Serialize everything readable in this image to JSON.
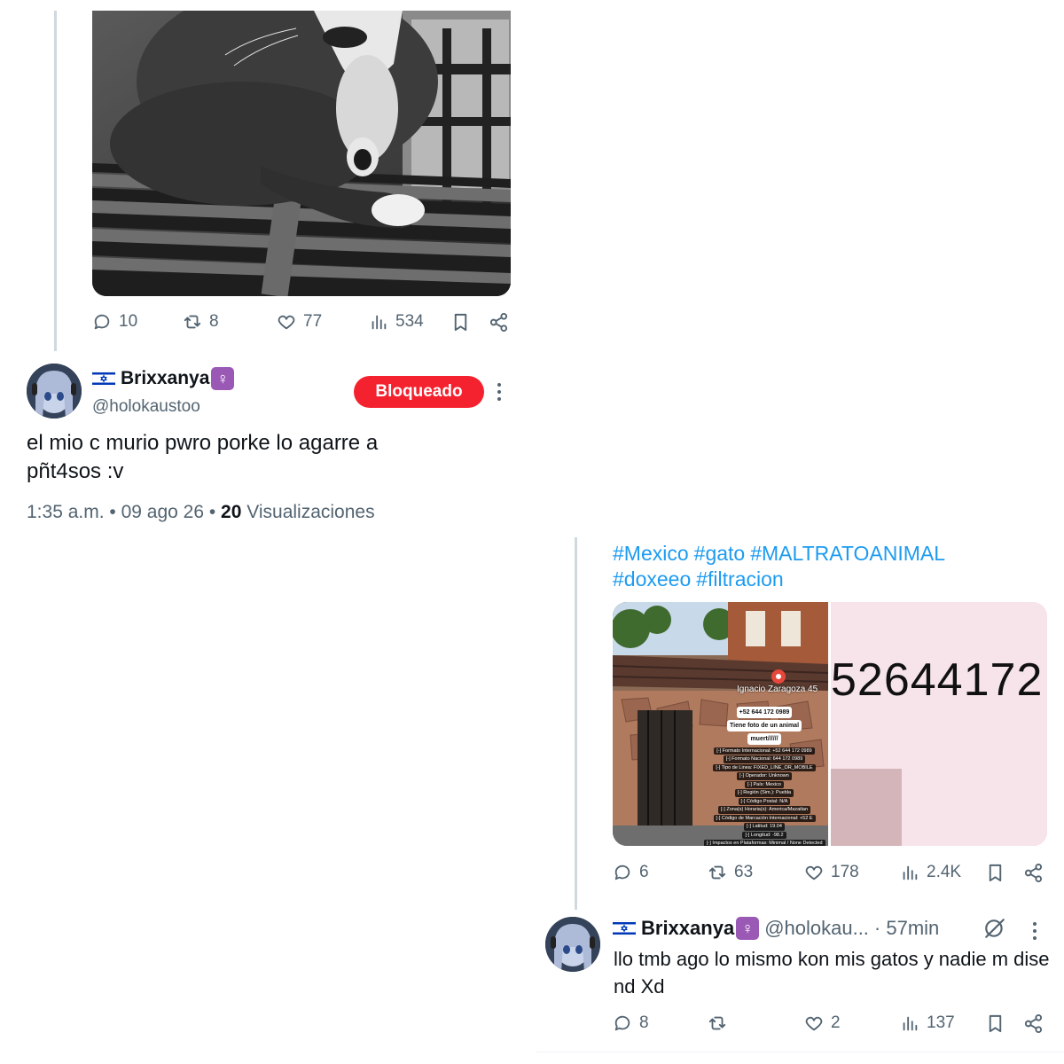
{
  "top_post": {
    "stats": {
      "replies": "10",
      "reposts": "8",
      "likes": "77",
      "views": "534"
    }
  },
  "quoted_reply": {
    "user": {
      "display_name": "Brixxanya",
      "gender_symbol": "♀️",
      "handle": "@holokaustoo",
      "flag": "israel-flag"
    },
    "blocked_button_label": "Bloqueado",
    "text_line1": "el mio c murio pwro porke lo agarre a",
    "text_line2": "pñt4sos :v",
    "timestamp": "1:35 a.m. • 09 ago 26 •",
    "views_count": "20",
    "views_label": "Visualizaciones"
  },
  "right_post": {
    "hashtags": [
      "#Mexico",
      "#gato",
      "#MALTRATOANIMAL",
      "#doxeeo",
      "#filtracion"
    ],
    "media": {
      "street_label": "Ignacio Zaragoza 45",
      "dox_lines": [
        "+52 644 172 0989",
        "Tiene foto de un animal",
        "muert//////",
        "[-] Formato Internacional: +52 644 172 0989",
        "[-] Formato Nacional: 644 172 0989",
        "[-] Tipo de Linea: FIXED_LINE_OR_MOBILE",
        "[-] Operador: Unknown",
        "[-] País: Mexico",
        "[-] Región (Sim.): Puebla",
        "[-] Código Postal: N/A",
        "[-] Zona(s) Horaria(s): America/Mazatlan",
        "[-] Código de Marcación Internacional: +52 E",
        "[-] Latitud: 19.04",
        "[-] Longitud: -98.2",
        "[-] Impactos en Plataformas: Minimal / None Detected"
      ],
      "phone_digits": "52644172"
    },
    "stats": {
      "replies": "6",
      "reposts": "63",
      "likes": "178",
      "views": "2.4K"
    }
  },
  "right_reply": {
    "user": {
      "display_name": "Brixxanya",
      "gender_symbol": "♀️",
      "handle": "@holokau...",
      "time": "· 57min",
      "flag": "israel-flag"
    },
    "text": "llo tmb ago lo mismo kon mis gatos y nadie m dise nd Xd",
    "stats": {
      "replies": "8",
      "reposts": "",
      "likes": "2",
      "views": "137"
    }
  },
  "colors": {
    "blocked_red": "#f4212e",
    "hashtag_blue": "#1d9bf0",
    "muted_gray": "#536471",
    "text": "#0f1419"
  }
}
